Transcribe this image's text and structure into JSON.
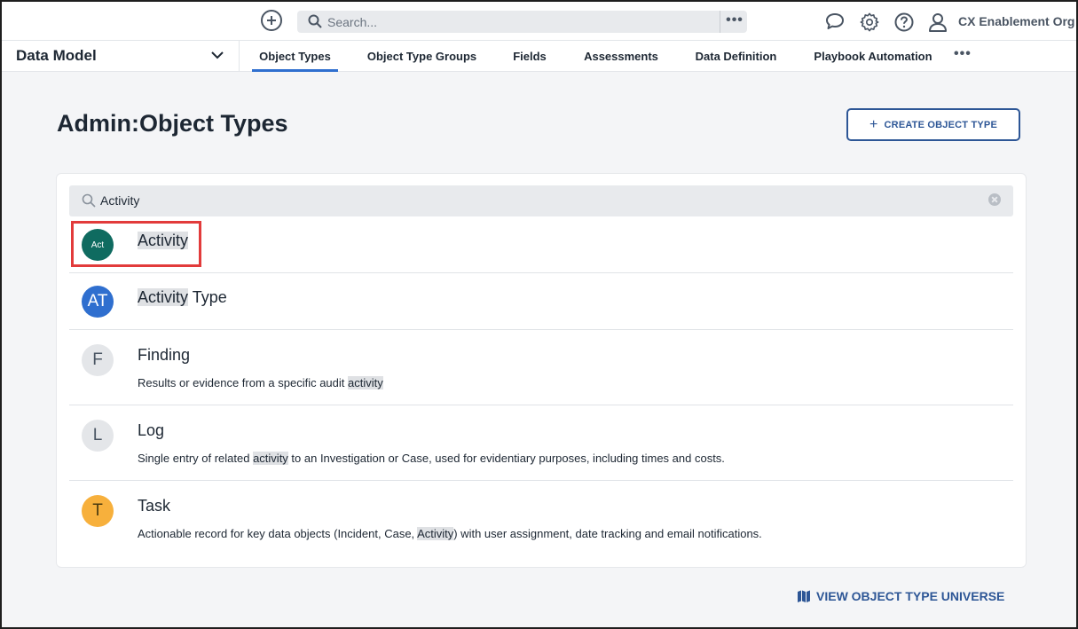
{
  "topbar": {
    "search_placeholder": "Search...",
    "more_label": "•••",
    "org_name": "CX Enablement Org"
  },
  "nav": {
    "section": "Data Model",
    "tabs": [
      {
        "label": "Object Types",
        "active": true
      },
      {
        "label": "Object Type Groups",
        "active": false
      },
      {
        "label": "Fields",
        "active": false
      },
      {
        "label": "Assessments",
        "active": false
      },
      {
        "label": "Data Definition",
        "active": false
      },
      {
        "label": "Playbook Automation",
        "active": false
      }
    ],
    "more_label": "•••"
  },
  "page": {
    "title_prefix": "Admin",
    "title_sep": ":",
    "title": "Object Types",
    "create_button": "CREATE OBJECT TYPE"
  },
  "filter": {
    "value": "Activity"
  },
  "rows": [
    {
      "initials": "Act",
      "color": "#0f6b60",
      "title_hl": "Activity",
      "title_rest": "",
      "desc_pre": "",
      "desc_hl": "",
      "desc_post": ""
    },
    {
      "initials": "AT",
      "color": "#2f6fcf",
      "title_hl": "Activity",
      "title_rest": " Type",
      "desc_pre": "",
      "desc_hl": "",
      "desc_post": ""
    },
    {
      "initials": "F",
      "color": "#e4e6e9",
      "title_hl": "",
      "title_rest": "Finding",
      "desc_pre": "Results or evidence from a specific audit ",
      "desc_hl": "activity",
      "desc_post": ""
    },
    {
      "initials": "L",
      "color": "#e4e6e9",
      "title_hl": "",
      "title_rest": "Log",
      "desc_pre": "Single entry of related ",
      "desc_hl": "activity",
      "desc_post": " to an Investigation or Case, used for evidentiary purposes, including times and costs."
    },
    {
      "initials": "T",
      "color": "#f7b03c",
      "title_hl": "",
      "title_rest": "Task",
      "desc_pre": "Actionable record for key data objects (Incident, Case, ",
      "desc_hl": "Activity",
      "desc_post": ") with user assignment, date tracking and email notifications."
    }
  ],
  "footer": {
    "universe_link": "VIEW OBJECT TYPE UNIVERSE"
  },
  "colors": {
    "accent": "#2d5696",
    "tab_active": "#2f6fcf",
    "highlight_box": "#e23b3b"
  }
}
